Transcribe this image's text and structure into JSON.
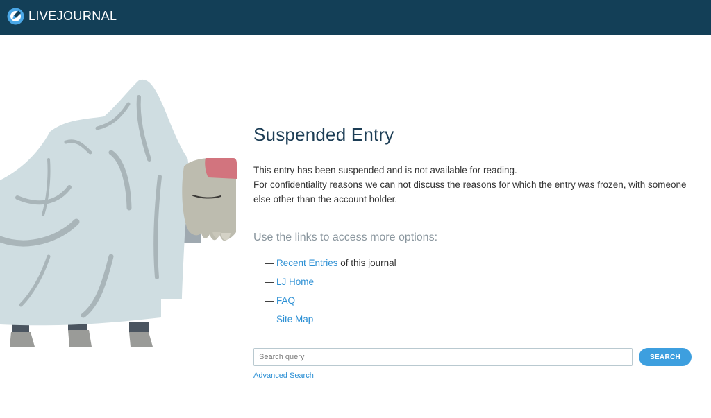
{
  "header": {
    "logo_text": "LIVEJOURNAL",
    "background_color": "#133f57"
  },
  "illustration": {
    "subject": "ghost-yak"
  },
  "main": {
    "title": "Suspended Entry",
    "message_line_1": "This entry has been suspended and is not available for reading.",
    "message_line_2": "For confidentiality reasons we can not discuss the reasons for which the entry was frozen, with someone else other than the account holder.",
    "options_heading": "Use the links to access more options:",
    "dash": "—",
    "links": [
      {
        "label": "Recent Entries",
        "suffix": " of this journal"
      },
      {
        "label": "LJ Home",
        "suffix": ""
      },
      {
        "label": "FAQ",
        "suffix": ""
      },
      {
        "label": "Site Map",
        "suffix": ""
      }
    ]
  },
  "search": {
    "placeholder": "Search query",
    "value": "",
    "button_label": "SEARCH",
    "advanced_link": "Advanced Search"
  },
  "colors": {
    "link": "#2b8fd4",
    "button": "#3d9fdf",
    "title": "#1c3d55"
  }
}
